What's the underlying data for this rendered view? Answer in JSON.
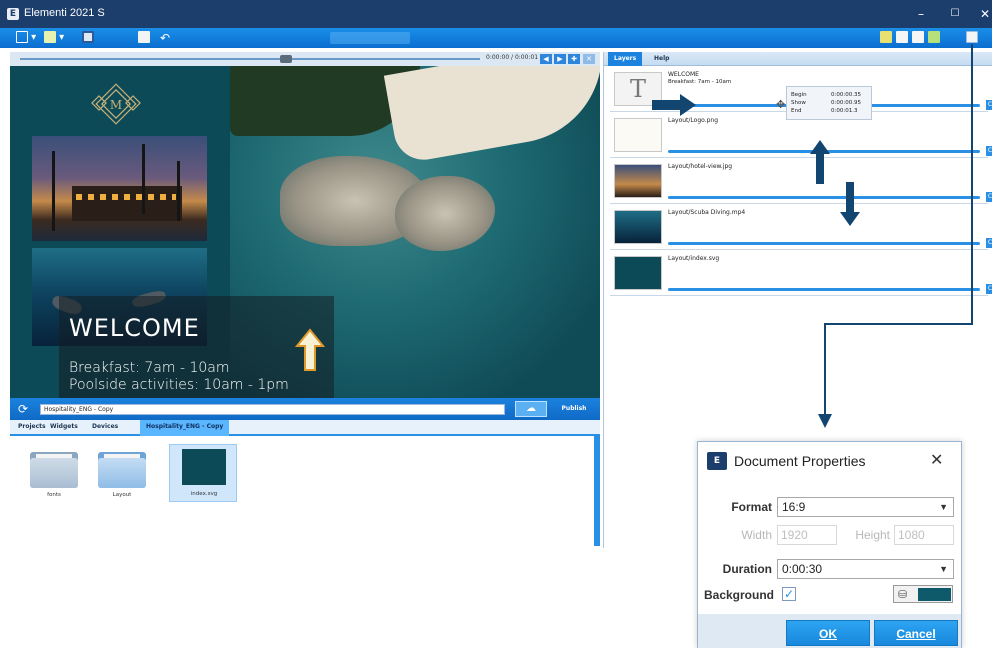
{
  "window": {
    "title": "Elementi 2021 S",
    "min_glyph": "–",
    "max_glyph": "☐",
    "close_glyph": "✕"
  },
  "player": {
    "timecode": "0:00:00 / 0:00:01"
  },
  "preview": {
    "logo_letter": "M",
    "welcome": "WELCOME",
    "line1": "Breakfast: 7am - 10am",
    "line2": "Poolside activities: 10am - 1pm"
  },
  "project": {
    "path": "Hospitality_ENG - Copy",
    "publish_label": "Publish",
    "tabs": [
      "Projects",
      "Widgets",
      "Devices",
      "Hospitality_ENG - Copy"
    ],
    "files": [
      "fonts",
      "Layout",
      "index.svg"
    ]
  },
  "layers": {
    "tabs": [
      "Layers",
      "Help"
    ],
    "rows": [
      {
        "name": "WELCOME",
        "sub": "Breakfast: 7am - 10am"
      },
      {
        "name": "Layout/Logo.png",
        "sub": ""
      },
      {
        "name": "Layout/hotel-view.jpg",
        "sub": ""
      },
      {
        "name": "Layout/Scuba Diving.mp4",
        "sub": ""
      },
      {
        "name": "Layout/index.svg",
        "sub": ""
      }
    ],
    "timing": {
      "begin_label": "Begin",
      "begin": "0:00:00.35",
      "show_label": "Show",
      "show": "0:00:00.95",
      "end_label": "End",
      "end": "0:00:01.3"
    }
  },
  "dialog": {
    "title": "Document Properties",
    "close_glyph": "✕",
    "format_label": "Format",
    "format_value": "16:9",
    "width_label": "Width",
    "width_value": "1920",
    "height_label": "Height",
    "height_value": "1080",
    "duration_label": "Duration",
    "duration_value": "0:00:30",
    "background_label": "Background",
    "background_checked": true,
    "background_color": "#0e5a6a",
    "ok_label": "OK",
    "cancel_label": "Cancel"
  },
  "colors": {
    "titlebar": "#1c3e6c",
    "accent": "#1b82de",
    "annotation": "#12456f"
  }
}
